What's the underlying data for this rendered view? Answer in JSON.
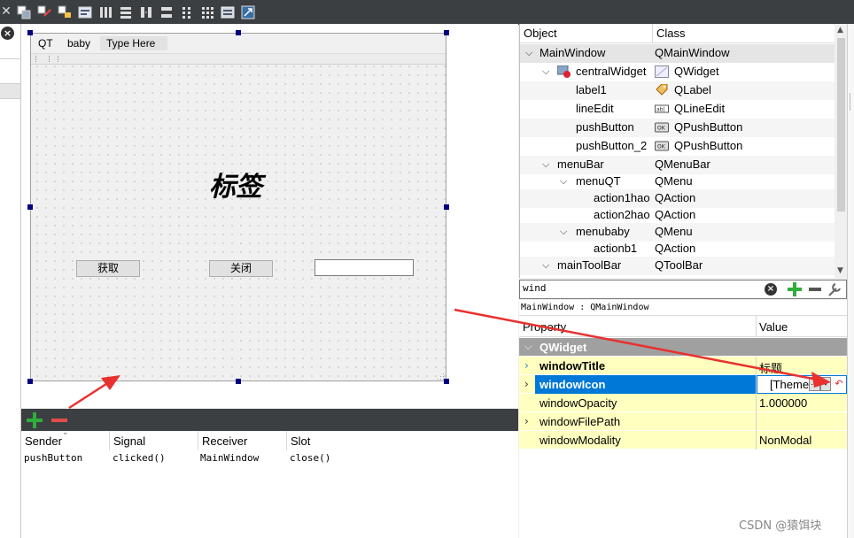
{
  "toolbar": {
    "close_glyph": "✕",
    "icons": [
      "edit-widgets-icon",
      "edit-signals-icon",
      "edit-buddies-icon",
      "edit-tab-order-icon",
      "layout-horizontal-icon",
      "layout-vertical-icon",
      "layout-hsplitter-icon",
      "layout-vsplitter-icon",
      "layout-form-icon",
      "layout-grid-icon",
      "break-layout-icon",
      "adjust-size-icon"
    ]
  },
  "form": {
    "menus": [
      "QT",
      "baby"
    ],
    "menu_placeholder": "Type Here",
    "label_text": "标签",
    "button_get": "获取",
    "button_close": "关闭",
    "line_edit_value": ""
  },
  "signal_slot": {
    "columns": [
      "Sender",
      "Signal",
      "Receiver",
      "Slot"
    ],
    "rows": [
      {
        "sender": "pushButton",
        "signal": "clicked()",
        "receiver": "MainWindow",
        "slot": "close()"
      }
    ]
  },
  "object_inspector": {
    "columns": [
      "Object",
      "Class"
    ],
    "rows": [
      {
        "object": "MainWindow",
        "class": "QMainWindow",
        "icon": "",
        "chevron": "down"
      },
      {
        "object": "centralWidget",
        "class": "QWidget",
        "icon": "widget-icon",
        "chevron": "down"
      },
      {
        "object": "label1",
        "class": "QLabel",
        "icon": "label-icon",
        "chevron": ""
      },
      {
        "object": "lineEdit",
        "class": "QLineEdit",
        "icon": "lineedit-icon",
        "chevron": ""
      },
      {
        "object": "pushButton",
        "class": "QPushButton",
        "icon": "pushbutton-icon",
        "chevron": ""
      },
      {
        "object": "pushButton_2",
        "class": "QPushButton",
        "icon": "pushbutton-icon",
        "chevron": ""
      },
      {
        "object": "menuBar",
        "class": "QMenuBar",
        "icon": "",
        "chevron": "down"
      },
      {
        "object": "menuQT",
        "class": "QMenu",
        "icon": "",
        "chevron": "down"
      },
      {
        "object": "action1hao",
        "class": "QAction",
        "icon": "",
        "chevron": ""
      },
      {
        "object": "action2hao",
        "class": "QAction",
        "icon": "",
        "chevron": ""
      },
      {
        "object": "menubaby",
        "class": "QMenu",
        "icon": "",
        "chevron": "down"
      },
      {
        "object": "actionb1",
        "class": "QAction",
        "icon": "",
        "chevron": ""
      },
      {
        "object": "mainToolBar",
        "class": "QToolBar",
        "icon": "",
        "chevron": "down"
      }
    ]
  },
  "property_editor": {
    "filter_value": "wind",
    "object_name": "MainWindow : QMainWindow",
    "columns": [
      "Property",
      "Value"
    ],
    "group": "QWidget",
    "rows": [
      {
        "name": "windowTitle",
        "value": "标题",
        "expandable": true,
        "changed": true
      },
      {
        "name": "windowIcon",
        "value": "[Theme",
        "expandable": true,
        "changed": true,
        "selected": true
      },
      {
        "name": "windowOpacity",
        "value": "1.000000",
        "expandable": false,
        "changed": false
      },
      {
        "name": "windowFilePath",
        "value": "",
        "expandable": true,
        "changed": false
      },
      {
        "name": "windowModality",
        "value": "NonModal",
        "expandable": false,
        "changed": false
      }
    ],
    "browse_glyph": "...",
    "dropdown_glyph": "▾",
    "reset_glyph": "↶"
  },
  "colors": {
    "toolbar_bg": "#3c3f41",
    "selection_blue": "#0078d7",
    "group_header": "#a0a0a0",
    "changed_row": "#ffffc0",
    "handle": "#000080",
    "annotation_red": "#e8312f",
    "add_green": "#2eae3a",
    "remove_red": "#e24b4b"
  },
  "watermark": "CSDN @猿饵块"
}
